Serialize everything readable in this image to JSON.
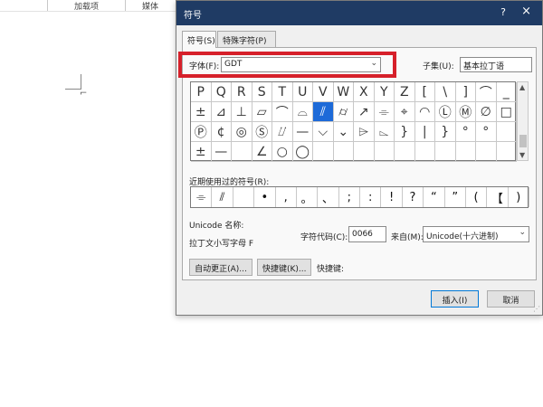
{
  "word": {
    "ribbon_items": [
      "加载项",
      "媒体"
    ]
  },
  "dialog": {
    "title": "符号",
    "help": "?",
    "close": "×",
    "tabs": [
      "符号(S)",
      "特殊字符(P)"
    ],
    "font_label": "字体(F):",
    "font_value": "GDT",
    "subset_label": "子集(U):",
    "subset_value": "基本拉丁语",
    "symbols": [
      [
        "P",
        "Q",
        "R",
        "S",
        "T",
        "U",
        "V",
        "W",
        "X",
        "Y",
        "Z",
        "[",
        "\\",
        "]",
        "⌒",
        "_"
      ],
      [
        "±",
        "⊿",
        "⊥",
        "⏥",
        "⌒",
        "⌓",
        "⫽",
        "⌭",
        "↗",
        "⌯",
        "⌖",
        "◠",
        "Ⓛ",
        "Ⓜ",
        "∅",
        "□"
      ],
      [
        "Ⓟ",
        "¢",
        "◎",
        "Ⓢ",
        "⌰",
        "—",
        "⌵",
        "⌄",
        "⌲",
        "⌳",
        "}",
        "|",
        "}",
        "°",
        "°",
        ""
      ],
      [
        "±",
        "—",
        "",
        "∠",
        "○",
        "◯",
        "",
        "",
        "",
        "",
        "",
        "",
        "",
        "",
        "",
        ""
      ]
    ],
    "selected_symbol": "⫽",
    "recent_label": "近期使用过的符号(R):",
    "recent": [
      "⌯",
      "⫽",
      "",
      "•",
      ",",
      "。",
      "、",
      ";",
      ":",
      "!",
      "?",
      "“",
      "”",
      "(",
      "【",
      ")"
    ],
    "unicode_name_label": "Unicode 名称:",
    "unicode_name_value": "拉丁文小写字母 F",
    "charcode_label": "字符代码(C):",
    "charcode_value": "0066",
    "from_label": "来自(M):",
    "from_value": "Unicode(十六进制)",
    "autocorrect_button": "自动更正(A)...",
    "shortcut_button": "快捷键(K)...",
    "shortcut_label": "快捷键:",
    "insert_button": "插入(I)",
    "cancel_button": "取消"
  },
  "colors": {
    "titlebar": "#1f3b64",
    "highlight": "#d6202a",
    "selected_cell": "#1d6ad8"
  }
}
